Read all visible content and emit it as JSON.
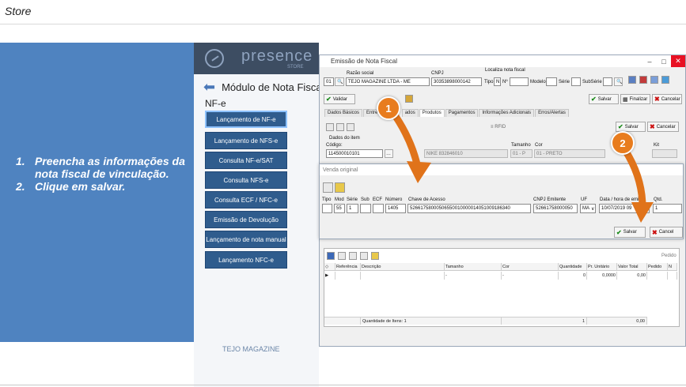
{
  "page": {
    "title": "Store"
  },
  "instructions": {
    "steps": [
      {
        "num": "1.",
        "text": "Preencha as informações da nota fiscal de vinculação."
      },
      {
        "num": "2.",
        "text": "Clique em salvar."
      }
    ]
  },
  "app": {
    "logo": "presence",
    "logo_sub": "STORE",
    "module_title": "Módulo de Nota Fiscal",
    "section_label": "NF-e",
    "menu": [
      "Lançamento de NF-e",
      "Lançamento de NFS-e",
      "Consulta NF-e/SAT",
      "Consulta NFS-e",
      "Consulta ECF / NFC-e",
      "Emissão de Devolução",
      "Lançamento de nota manual",
      "Lançamento NFC-e"
    ],
    "footer": "TEJO MAGAZINE"
  },
  "window": {
    "title": "Emissão de Nota Fiscal",
    "razao_label": "Razão social",
    "code": "01",
    "razao_value": "TEJO MAGAZINE LTDA - ME",
    "cnpj_label": "CNPJ",
    "cnpj_value": "30353898000142",
    "localiza_label": "Localiza nota fiscal",
    "tipo_label": "Tipo",
    "tipo_value": "N",
    "nf_label": "Nº",
    "modelo_label": "Modelo",
    "serie_label": "Série",
    "subserie_label": "SubSérie",
    "validar": "Validar",
    "salvar": "Salvar",
    "finalizar": "Finalizar",
    "cancelar": "Cancelar",
    "tabs": [
      "Dados Básicos",
      "Entreg",
      "ados",
      "Produtos",
      "Pagamentos",
      "Informações Adicionais",
      "Erros/Alertas"
    ],
    "rfid": "RFID",
    "item_salvar": "Salvar",
    "item_cancelar": "Cancelar",
    "dados_item_label": "Dados do item",
    "codigo_label": "Código:",
    "codigo_value": "114500010101",
    "produto_value": "NIKE 832846010",
    "tamanho_label": "Tamanho",
    "tamanho_value": "01 - P",
    "cor_label": "Cor",
    "cor_value": "01 - PRETO",
    "kit_label": "Kit"
  },
  "dialog": {
    "title": "Venda original",
    "headers": {
      "tipo": "Tipo",
      "mod": "Mod",
      "serie": "Série",
      "sub": "Sub",
      "ecf": "ECF",
      "numero": "Número",
      "chave": "Chave de Acesso",
      "cnpj": "CNPJ Emitente",
      "uf": "UF",
      "data": "Data / hora de emiss",
      "qtd": "Qtd."
    },
    "values": {
      "tipo": "",
      "mod": "55",
      "serie": "1",
      "sub": "",
      "ecf": "",
      "numero": "1405",
      "chave": "52661758000506550010000014051009186340",
      "cnpj": "52661758000050",
      "uf": "MA",
      "data": "10/07/2019 09",
      "qtd": "1"
    },
    "salvar": "Salvar",
    "cancel": "Cancel"
  },
  "grid": {
    "pedido": "Pedido",
    "columns": [
      "Referência",
      "Descrição",
      "Tamanho",
      "Cor",
      "Quantidade",
      "Pr. Unitário",
      "Valor Total",
      "Pedido",
      "N"
    ],
    "row": [
      "",
      "",
      "-",
      "-",
      "0",
      "0,0000",
      "0,00",
      "",
      ""
    ],
    "footer_label": "Quantidade de Itens: 1",
    "footer_qty": "1",
    "footer_total": "0,00"
  },
  "badges": [
    "1",
    "2"
  ]
}
